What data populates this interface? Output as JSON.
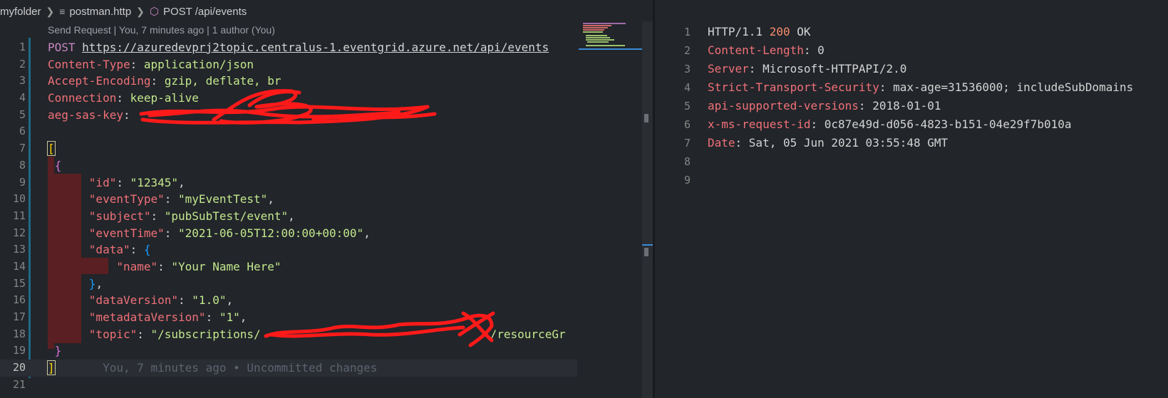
{
  "breadcrumb": {
    "folder": "myfolder",
    "file": "postman.http",
    "symbol": "POST /api/events"
  },
  "codelens": "Send Request | You, 7 minutes ago | 1 author (You)",
  "request": {
    "method": "POST",
    "url": "https://azuredevprj2topic.centralus-1.eventgrid.azure.net/api/events",
    "headers": [
      {
        "name": "Content-Type",
        "value": "application/json"
      },
      {
        "name": "Accept-Encoding",
        "value": "gzip, deflate, br"
      },
      {
        "name": "Connection",
        "value": "keep-alive"
      },
      {
        "name": "aeg-sas-key",
        "value": ""
      }
    ],
    "body": {
      "id_key": "\"id\"",
      "id_val": "\"12345\"",
      "eventType_key": "\"eventType\"",
      "eventType_val": "\"myEventTest\"",
      "subject_key": "\"subject\"",
      "subject_val": "\"pubSubTest/event\"",
      "eventTime_key": "\"eventTime\"",
      "eventTime_val": "\"2021-06-05T12:00:00+00:00\"",
      "data_key": "\"data\"",
      "name_key": "\"name\"",
      "name_val": "\"Your Name Here\"",
      "dataVersion_key": "\"dataVersion\"",
      "dataVersion_val": "\"1.0\"",
      "metadataVersion_key": "\"metadataVersion\"",
      "metadataVersion_val": "\"1\"",
      "topic_key": "\"topic\"",
      "topic_val": "\"/subscriptions/",
      "topic_tail": "/resourceGr"
    },
    "blame": "You, 7 minutes ago • Uncommitted changes",
    "line_numbers": [
      "1",
      "2",
      "3",
      "4",
      "5",
      "6",
      "7",
      "8",
      "9",
      "10",
      "11",
      "12",
      "13",
      "14",
      "15",
      "16",
      "17",
      "18",
      "19",
      "20",
      "21"
    ]
  },
  "response": {
    "line_numbers": [
      "1",
      "2",
      "3",
      "4",
      "5",
      "6",
      "7",
      "8",
      "9"
    ],
    "protocol": "HTTP/1.1",
    "status_code": "200",
    "status_text": "OK",
    "headers": [
      {
        "name": "Content-Length",
        "value": "0"
      },
      {
        "name": "Server",
        "value": "Microsoft-HTTPAPI/2.0"
      },
      {
        "name": "Strict-Transport-Security",
        "value": "max-age=31536000; includeSubDomains"
      },
      {
        "name": "api-supported-versions",
        "value": "2018-01-01"
      },
      {
        "name": "x-ms-request-id",
        "value": "0c87e49d-d056-4823-b151-04e29f7b010a"
      },
      {
        "name": "Date",
        "value": "Sat, 05 Jun 2021 03:55:48 GMT"
      }
    ]
  },
  "icons": {
    "chevron": "chevron-right-icon",
    "file": "file-lines-icon",
    "symbol": "cube-icon"
  },
  "colors": {
    "background": "#22252a",
    "header_name": "#f07178",
    "string": "#c3e88d",
    "keyword": "#c586c0",
    "status": "#f78c6c",
    "redaction": "#ff0000"
  }
}
